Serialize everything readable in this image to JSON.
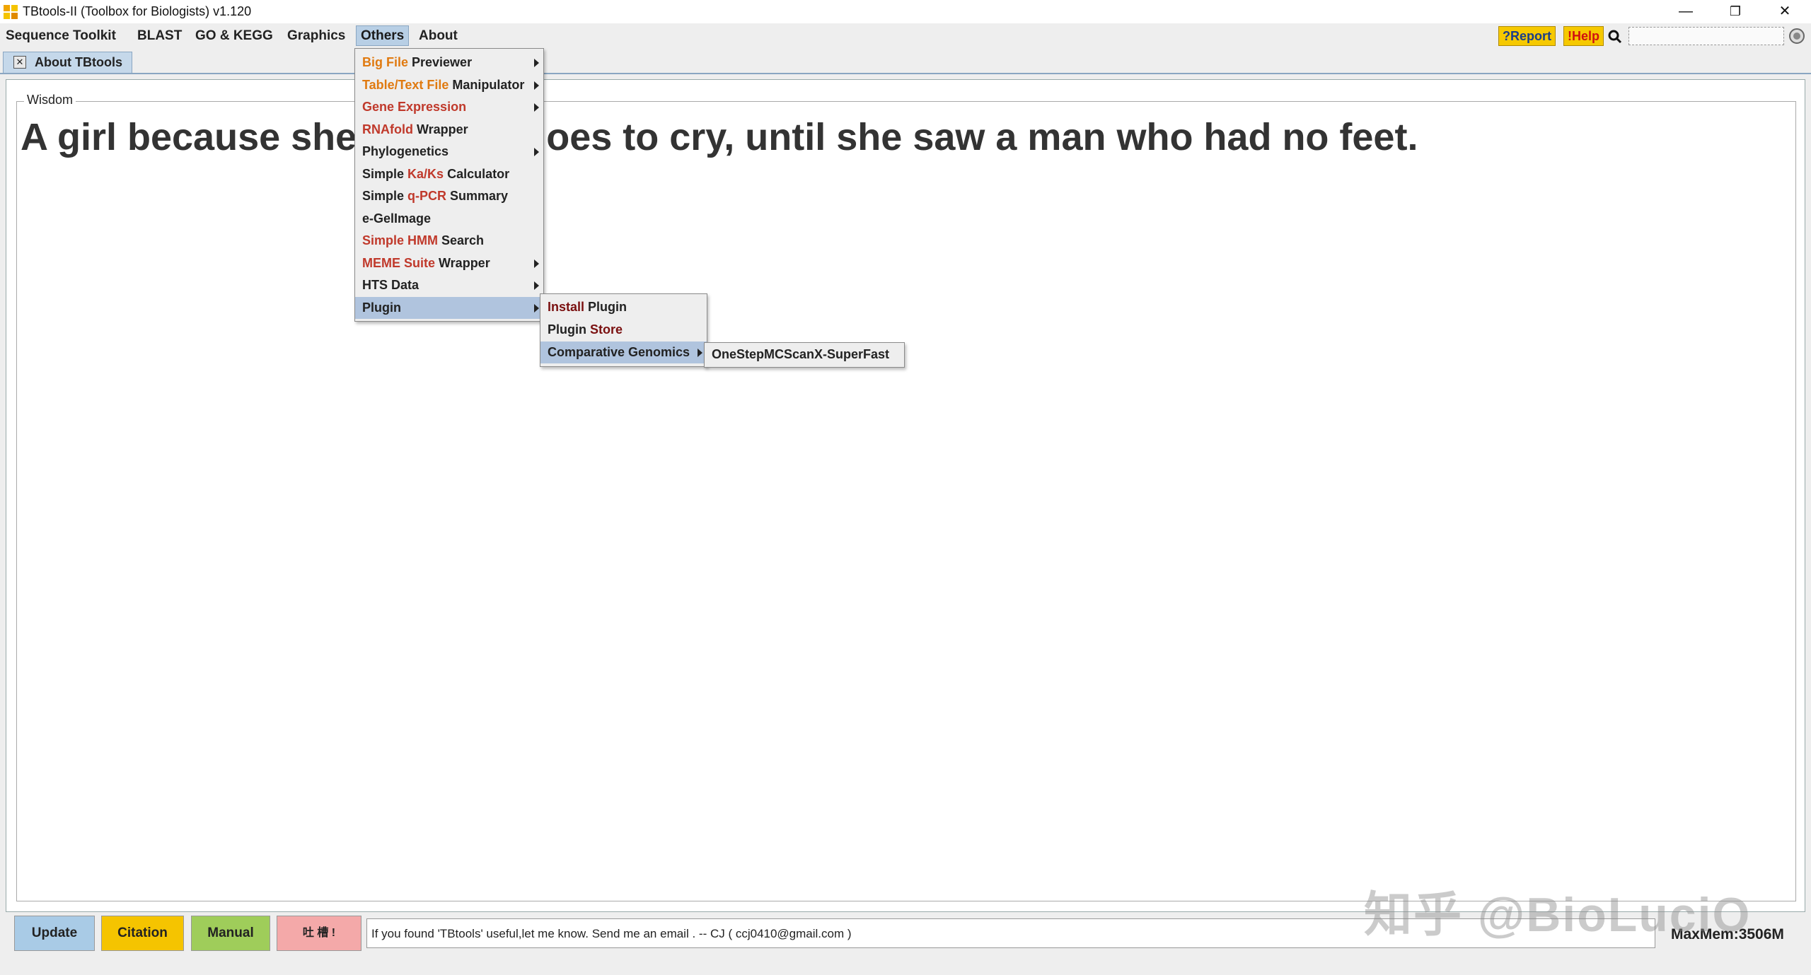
{
  "window": {
    "title": "TBtools-II (Toolbox for Biologists) v1.120",
    "minimize": "—",
    "restore": "❐",
    "close": "✕"
  },
  "menubar": {
    "items": [
      "Sequence Toolkit",
      "BLAST",
      "GO & KEGG",
      "Graphics",
      "Others",
      "About"
    ],
    "active": "Others",
    "report_label": "?Report",
    "help_label": "!Help"
  },
  "tab": {
    "close_glyph": "✕",
    "label": "About TBtools"
  },
  "content": {
    "legend": "Wisdom",
    "quote_visible_left": "A girl because she",
    "quote_visible_right": "oes to cry, until she saw a man who had no feet."
  },
  "others_menu": {
    "items": [
      {
        "parts": [
          {
            "t": "Big File",
            "c": "orange"
          },
          {
            "t": " Previewer",
            "c": ""
          }
        ],
        "submenu": true
      },
      {
        "parts": [
          {
            "t": "Table/Text File",
            "c": "orange"
          },
          {
            "t": " Manipulator",
            "c": ""
          }
        ],
        "submenu": true
      },
      {
        "parts": [
          {
            "t": "Gene Expression",
            "c": "red"
          }
        ],
        "submenu": true
      },
      {
        "parts": [
          {
            "t": "RNAfold",
            "c": "red"
          },
          {
            "t": " Wrapper",
            "c": ""
          }
        ],
        "submenu": false
      },
      {
        "parts": [
          {
            "t": "Phylogenetics",
            "c": ""
          }
        ],
        "submenu": true
      },
      {
        "parts": [
          {
            "t": "Simple ",
            "c": ""
          },
          {
            "t": "Ka/Ks",
            "c": "red"
          },
          {
            "t": " Calculator",
            "c": ""
          }
        ],
        "submenu": false
      },
      {
        "parts": [
          {
            "t": "Simple ",
            "c": ""
          },
          {
            "t": "q-PCR",
            "c": "red"
          },
          {
            "t": " Summary",
            "c": ""
          }
        ],
        "submenu": false
      },
      {
        "parts": [
          {
            "t": "e-GelImage",
            "c": ""
          }
        ],
        "submenu": false
      },
      {
        "parts": [
          {
            "t": "Simple HMM",
            "c": "red"
          },
          {
            "t": " Search",
            "c": ""
          }
        ],
        "submenu": false
      },
      {
        "parts": [
          {
            "t": "MEME Suite",
            "c": "red"
          },
          {
            "t": " Wrapper",
            "c": ""
          }
        ],
        "submenu": true
      },
      {
        "parts": [
          {
            "t": "HTS Data",
            "c": ""
          }
        ],
        "submenu": true
      },
      {
        "parts": [
          {
            "t": "Plugin",
            "c": ""
          }
        ],
        "submenu": true,
        "selected": true
      }
    ]
  },
  "plugin_menu": {
    "items": [
      {
        "parts": [
          {
            "t": "Install",
            "c": "dark"
          },
          {
            "t": " Plugin",
            "c": ""
          }
        ],
        "submenu": false
      },
      {
        "parts": [
          {
            "t": "Plugin ",
            "c": ""
          },
          {
            "t": "Store",
            "c": "dark"
          }
        ],
        "submenu": false
      },
      {
        "parts": [
          {
            "t": "Comparative Genomics",
            "c": ""
          }
        ],
        "submenu": true,
        "selected": true
      }
    ]
  },
  "genomics_menu": {
    "items": [
      {
        "parts": [
          {
            "t": "OneStepMCScanX-SuperFast",
            "c": ""
          }
        ],
        "submenu": false
      }
    ]
  },
  "footer": {
    "update_label": "Update",
    "citation_label": "Citation",
    "manual_label": "Manual",
    "donate_label": "吐 槽 !",
    "message": "If you found 'TBtools' useful,let me know. Send me an email . -- CJ    ( ccj0410@gmail.com )",
    "maxmem": "MaxMem:3506M"
  },
  "watermark": "知乎 @BioLuciO",
  "colors": {
    "orange": "#e07a10",
    "red": "#c0392b",
    "dark": "#7a1010",
    "update_bg": "#a9cbe6",
    "citation_bg": "#f5c400",
    "manual_bg": "#9fcd5a",
    "donate_bg": "#f4a9a9",
    "selection": "#b0c4de"
  }
}
